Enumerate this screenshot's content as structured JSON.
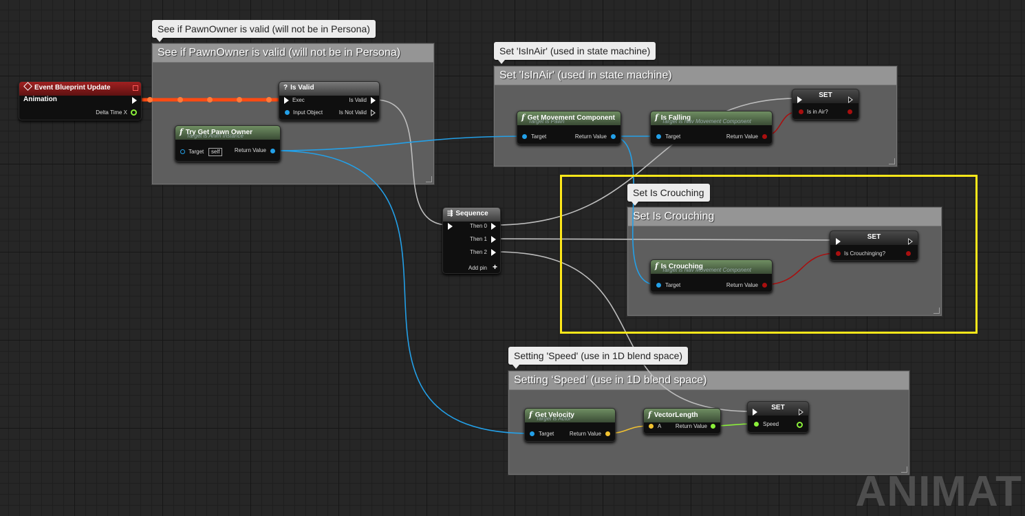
{
  "comments": {
    "pawn": "See if PawnOwner is valid (will not be in Persona)",
    "air": "Set 'IsInAir' (used in state machine)",
    "crouch": "Set Is Crouching",
    "speed_bubble": "Setting 'Speed' (use in 1D blend space)",
    "speed_title": "Setting ‘Speed’ (use in 1D blend space)"
  },
  "nodes": {
    "event_update": {
      "title": "Event Blueprint Update Animation",
      "pin_delta": "Delta Time X"
    },
    "is_valid": {
      "title": "Is Valid",
      "pin_exec": "Exec",
      "pin_input": "Input Object",
      "pin_valid": "Is Valid",
      "pin_not_valid": "Is Not Valid"
    },
    "try_get_pawn": {
      "title": "Try Get Pawn Owner",
      "subtitle": "Target is Anim Instance",
      "pin_target": "Target",
      "self_label": "self",
      "pin_return": "Return Value"
    },
    "get_movement": {
      "title": "Get Movement Component",
      "subtitle": "Target is Pawn",
      "pin_target": "Target",
      "pin_return": "Return Value"
    },
    "is_falling": {
      "title": "Is Falling",
      "subtitle": "Target is Nav Movement Component",
      "pin_target": "Target",
      "pin_return": "Return Value"
    },
    "set_air": {
      "title": "SET",
      "pin": "Is in Air?"
    },
    "sequence": {
      "title": "Sequence",
      "then0": "Then 0",
      "then1": "Then 1",
      "then2": "Then 2",
      "add_pin": "Add pin"
    },
    "is_crouching": {
      "title": "Is Crouching",
      "subtitle": "Target is Nav Movement Component",
      "pin_target": "Target",
      "pin_return": "Return Value"
    },
    "set_crouch": {
      "title": "SET",
      "pin": "Is Crouchinging?"
    },
    "get_velocity": {
      "title": "Get Velocity",
      "subtitle": "Target is Actor",
      "pin_target": "Target",
      "pin_return": "Return Value"
    },
    "vector_length": {
      "title": "VectorLength",
      "pin_a": "A",
      "pin_return": "Return Value"
    },
    "set_speed": {
      "title": "SET",
      "pin": "Speed"
    }
  },
  "watermark": "ANIMATIC",
  "colors": {
    "exec_wire": "#ffffff",
    "object_wire": "#23a0e8",
    "bool_wire": "#a80f0f",
    "float_wire": "#8bf03a",
    "vector_wire": "#f2c230",
    "active_exec": "#ff4a12",
    "highlight": "#ffe81a"
  }
}
